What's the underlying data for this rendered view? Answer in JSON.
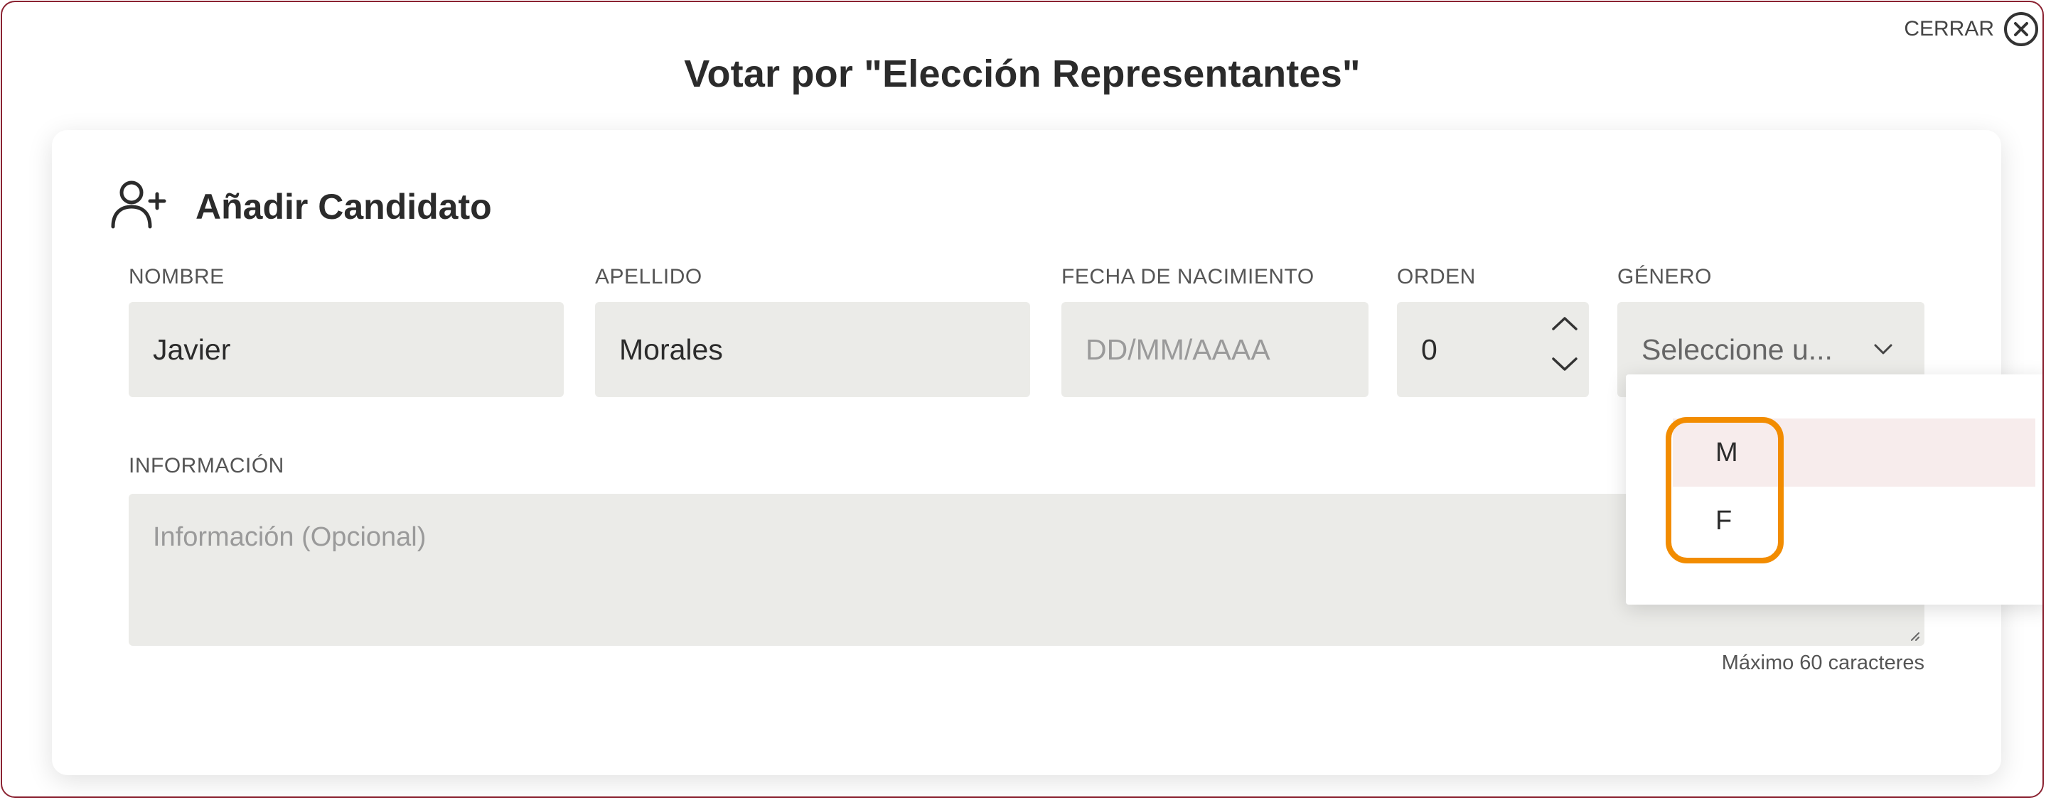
{
  "dialog": {
    "title": "Votar por \"Elección Representantes\"",
    "close_label": "CERRAR"
  },
  "card": {
    "title": "Añadir Candidato",
    "icon": "user-plus-icon"
  },
  "form": {
    "nombre": {
      "label": "NOMBRE",
      "value": "Javier"
    },
    "apellido": {
      "label": "APELLIDO",
      "value": "Morales"
    },
    "fecha": {
      "label": "FECHA DE NACIMIENTO",
      "placeholder": "DD/MM/AAAA"
    },
    "orden": {
      "label": "ORDEN",
      "value": "0"
    },
    "genero": {
      "label": "GÉNERO",
      "placeholder": "Seleccione u..."
    },
    "informacion": {
      "label": "INFORMACIÓN",
      "placeholder": "Información (Opcional)",
      "hint": "Máximo 60 caracteres"
    }
  },
  "dropdown": {
    "options": [
      "M",
      "F"
    ],
    "hovered": "M"
  },
  "colors": {
    "border": "#8b2332",
    "field_bg": "#ebebe8",
    "highlight": "#f28c00",
    "hover_bg": "#f7ecec"
  }
}
